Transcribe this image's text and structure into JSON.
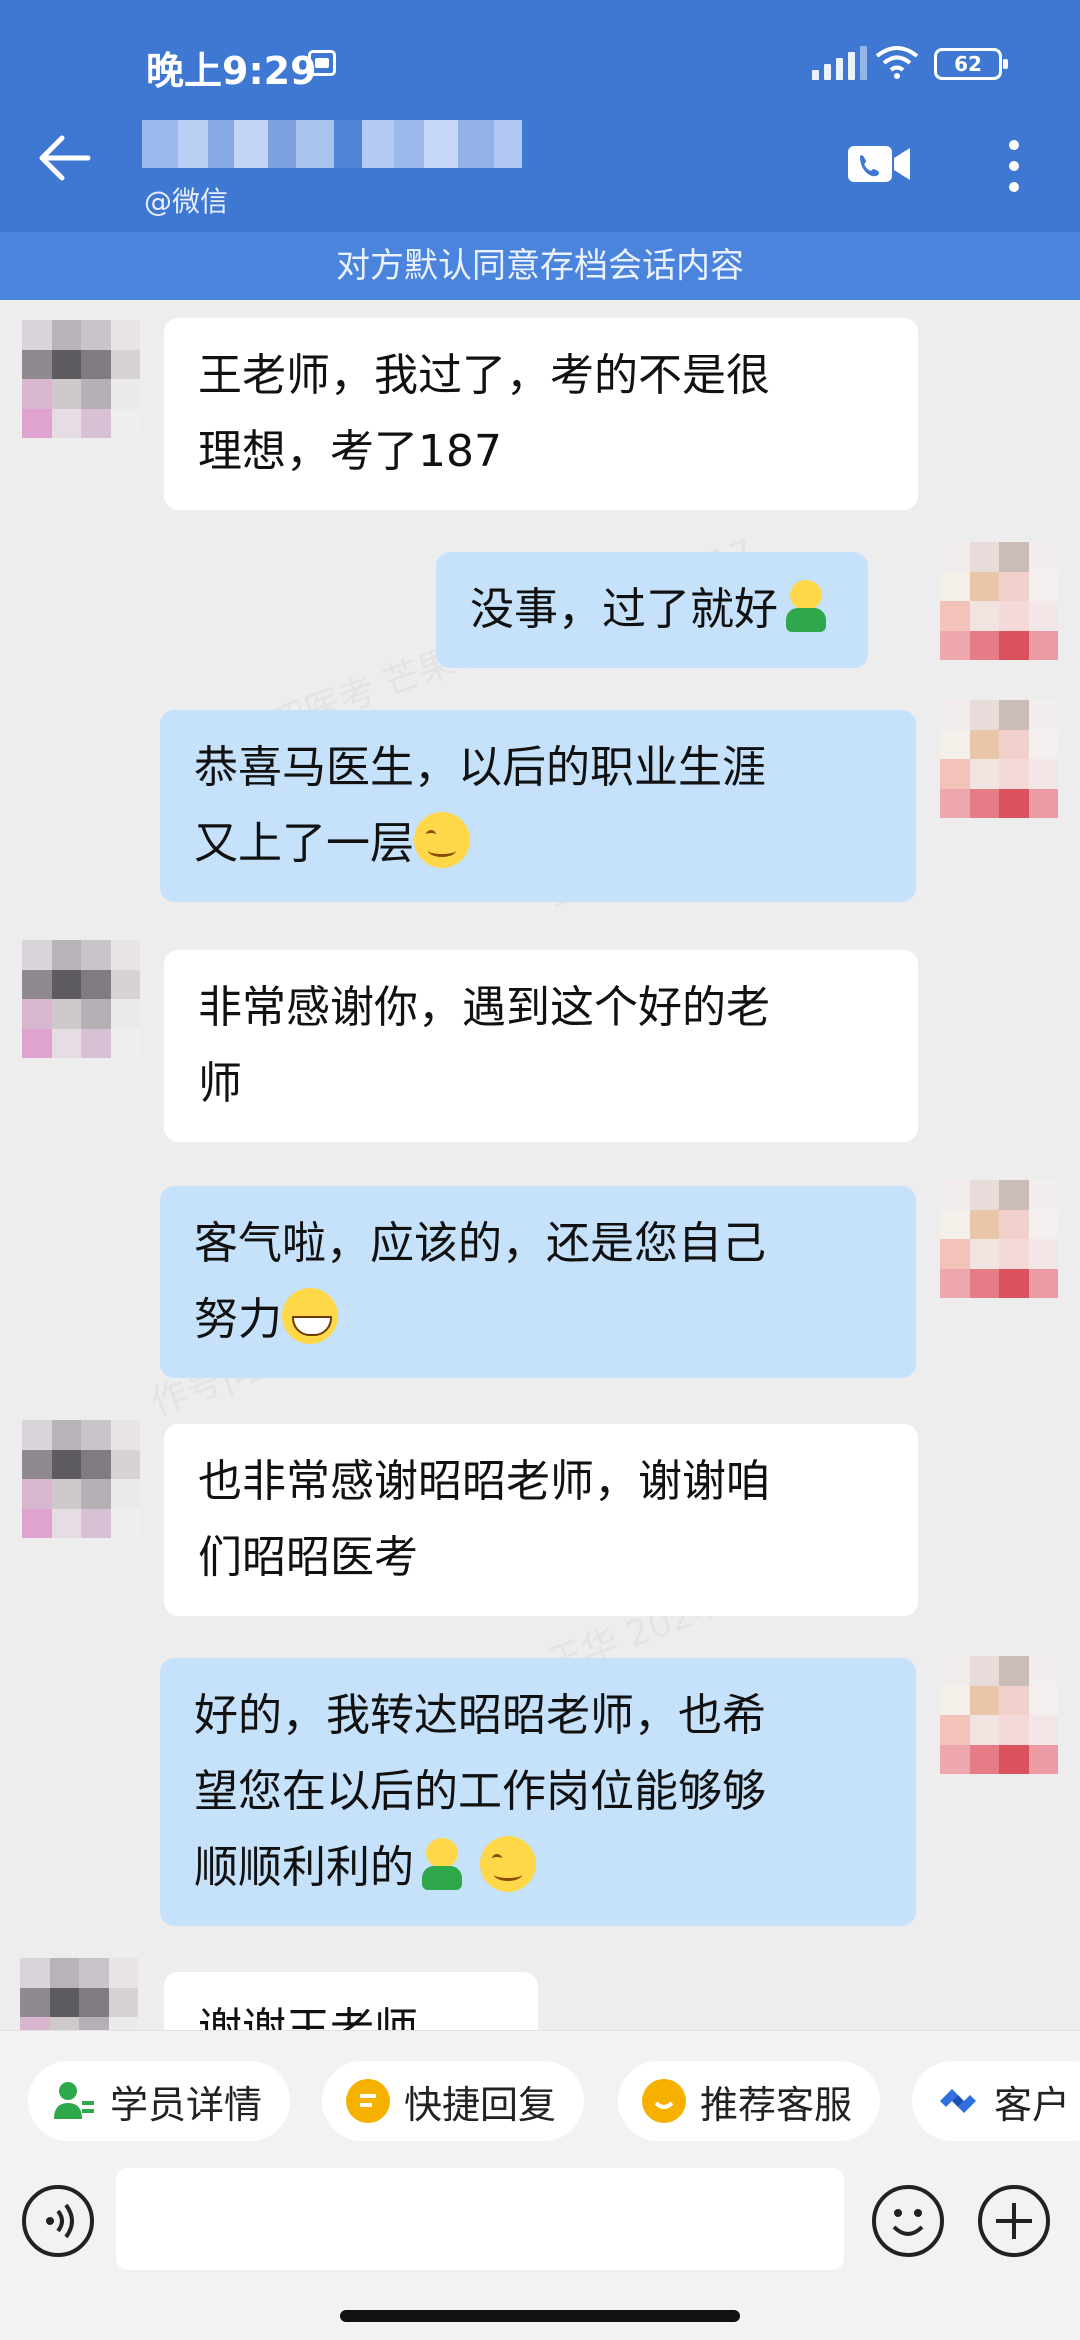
{
  "status_bar": {
    "time": "晚上9:29",
    "battery": "62",
    "icons": [
      "app-notification-icon",
      "signal-icon",
      "wifi-icon",
      "battery-icon"
    ]
  },
  "header": {
    "contact_name_blurred": true,
    "subtitle": "@微信",
    "icons": [
      "back-arrow-icon",
      "video-call-icon",
      "more-vertical-icon"
    ]
  },
  "notice": "对方默认同意存档会话内容",
  "messages": [
    {
      "side": "in",
      "text": "王老师，我过了，考的不是很理想，考了187",
      "lines": [
        "王老师，我过了，考的不是很",
        "理想，考了187"
      ],
      "emojis": []
    },
    {
      "side": "out",
      "text": "没事，过了就好",
      "lines": [
        "没事，过了就好"
      ],
      "emojis": [
        "hug"
      ]
    },
    {
      "side": "out",
      "text": "恭喜马医生，以后的职业生涯又上了一层",
      "lines": [
        "恭喜马医生，以后的职业生涯",
        "又上了一层"
      ],
      "emojis": [
        "smile"
      ]
    },
    {
      "side": "in",
      "text": "非常感谢你，遇到这个好的老师",
      "lines": [
        "非常感谢你，遇到这个好的老",
        "师"
      ],
      "emojis": []
    },
    {
      "side": "out",
      "text": "客气啦，应该的，还是您自己努力",
      "lines": [
        "客气啦，应该的，还是您自己",
        "努力"
      ],
      "emojis": [
        "grin"
      ]
    },
    {
      "side": "in",
      "text": "也非常感谢昭昭老师，谢谢咱们昭昭医考",
      "lines": [
        "也非常感谢昭昭老师，谢谢咱",
        "们昭昭医考"
      ],
      "emojis": []
    },
    {
      "side": "out",
      "text": "好的，我转达昭昭老师，也希望您在以后的工作岗位能够够顺顺利利的",
      "lines": [
        "好的，我转达昭昭老师，也希",
        "望您在以后的工作岗位能够够",
        "顺顺利利的"
      ],
      "emojis": [
        "hug",
        "smile"
      ]
    },
    {
      "side": "in",
      "text": "谢谢王老师",
      "lines": [
        "谢谢王老师"
      ],
      "emojis": []
    }
  ],
  "quick_actions": [
    {
      "label": "学员详情",
      "icon": "student-detail-icon",
      "color": "#2ea84b"
    },
    {
      "label": "快捷回复",
      "icon": "quick-reply-icon",
      "color": "#f5b000"
    },
    {
      "label": "推荐客服",
      "icon": "recommend-service-icon",
      "color": "#f5b000"
    },
    {
      "label": "客户",
      "icon": "customer-icon",
      "color": "#2f6fe0"
    }
  ],
  "input": {
    "placeholder": "",
    "icons": [
      "voice-input-icon",
      "emoji-icon",
      "add-icon"
    ]
  },
  "colors": {
    "header_bg": "#3f78d2",
    "notice_bg": "#4a84dd",
    "bubble_out": "#c6e2fb",
    "bubble_in": "#ffffff",
    "chat_bg": "#ededed"
  }
}
